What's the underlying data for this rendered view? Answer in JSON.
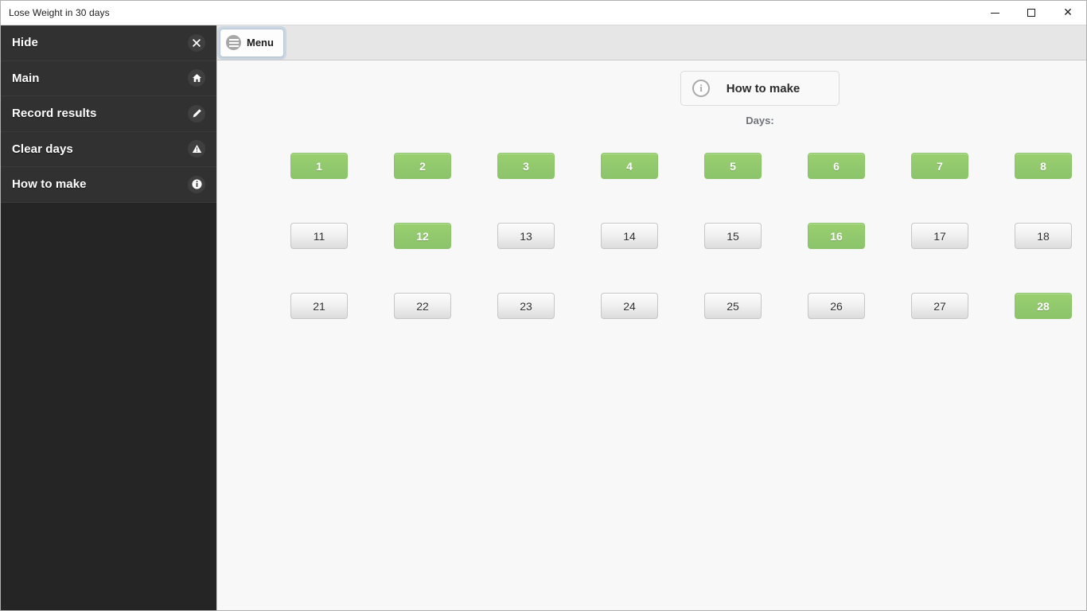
{
  "window": {
    "title": "Lose Weight in 30 days",
    "controls": {
      "minimize": "minimize-icon",
      "maximize": "maximize-icon",
      "close": "close-icon",
      "close_glyph": "✕"
    }
  },
  "sidebar": {
    "items": [
      {
        "label": "Hide",
        "icon": "close-icon"
      },
      {
        "label": "Main",
        "icon": "home-icon"
      },
      {
        "label": "Record results",
        "icon": "pencil-icon"
      },
      {
        "label": "Clear days",
        "icon": "warning-triangle-icon"
      },
      {
        "label": "How to make",
        "icon": "info-icon"
      }
    ]
  },
  "toolbar": {
    "menu_label": "Menu",
    "menu_icon": "hamburger-icon"
  },
  "content": {
    "howto_button": {
      "label": "How to make",
      "icon": "info-icon",
      "icon_glyph": "i"
    },
    "days_label": "Days:",
    "day_rows": [
      [
        {
          "number": "1",
          "selected": true
        },
        {
          "number": "2",
          "selected": true
        },
        {
          "number": "3",
          "selected": true
        },
        {
          "number": "4",
          "selected": true
        },
        {
          "number": "5",
          "selected": true
        },
        {
          "number": "6",
          "selected": true
        },
        {
          "number": "7",
          "selected": true
        },
        {
          "number": "8",
          "selected": true
        }
      ],
      [
        {
          "number": "11",
          "selected": false
        },
        {
          "number": "12",
          "selected": true
        },
        {
          "number": "13",
          "selected": false
        },
        {
          "number": "14",
          "selected": false
        },
        {
          "number": "15",
          "selected": false
        },
        {
          "number": "16",
          "selected": true
        },
        {
          "number": "17",
          "selected": false
        },
        {
          "number": "18",
          "selected": false
        }
      ],
      [
        {
          "number": "21",
          "selected": false
        },
        {
          "number": "22",
          "selected": false
        },
        {
          "number": "23",
          "selected": false
        },
        {
          "number": "24",
          "selected": false
        },
        {
          "number": "25",
          "selected": false
        },
        {
          "number": "26",
          "selected": false
        },
        {
          "number": "27",
          "selected": false
        },
        {
          "number": "28",
          "selected": true
        }
      ]
    ]
  },
  "colors": {
    "selected_day": "#8cc46b",
    "unselected_day": "#e6e6e6",
    "sidebar_bg": "#2a2a2a",
    "sidebar_item_bg": "#313131",
    "toolbar_bg": "#e6e6e6",
    "content_bg": "#f8f8f8"
  }
}
